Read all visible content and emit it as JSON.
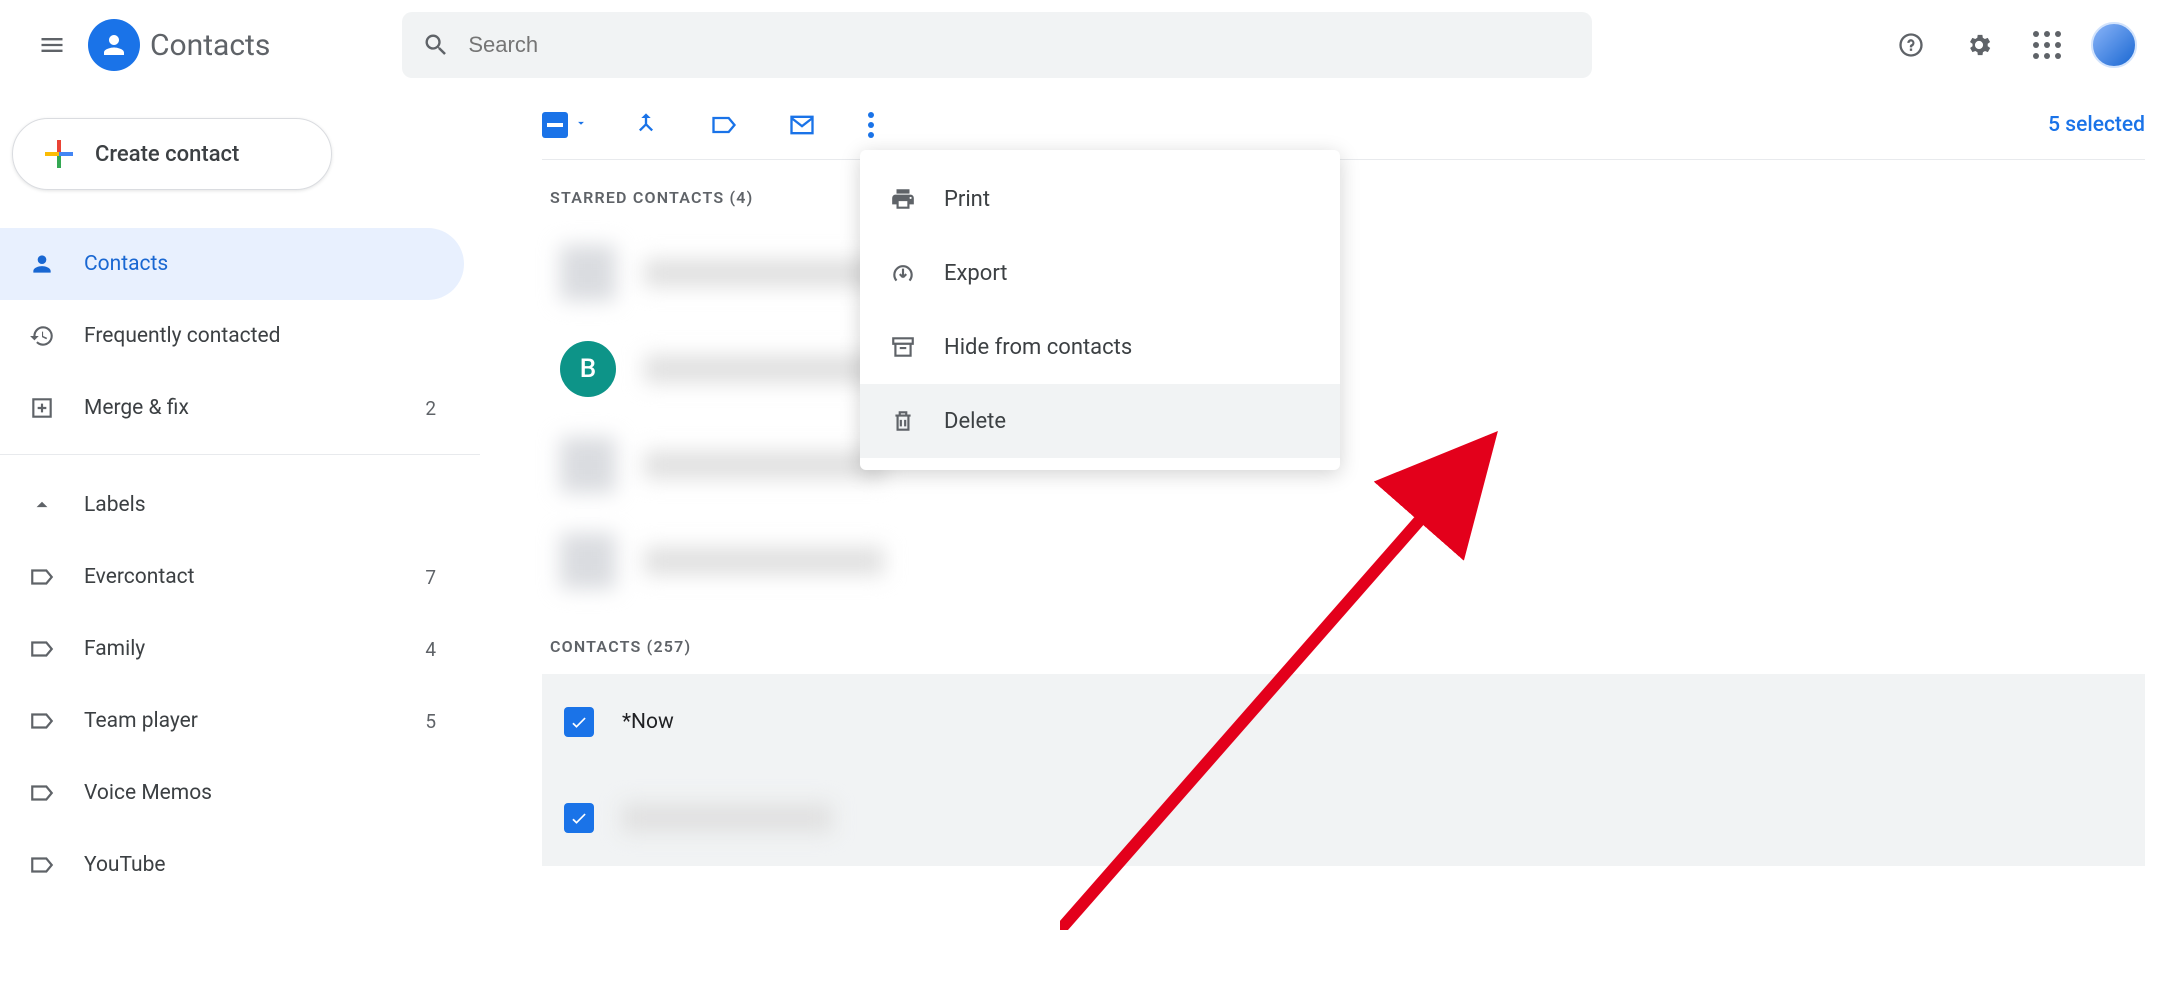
{
  "header": {
    "app_title": "Contacts",
    "search_placeholder": "Search"
  },
  "sidebar": {
    "create_label": "Create contact",
    "nav": {
      "contacts": "Contacts",
      "frequent": "Frequently contacted",
      "merge": "Merge & fix",
      "merge_count": "2"
    },
    "labels_header": "Labels",
    "labels": [
      {
        "name": "Evercontact",
        "count": "7"
      },
      {
        "name": "Family",
        "count": "4"
      },
      {
        "name": "Team player",
        "count": "5"
      },
      {
        "name": "Voice Memos",
        "count": ""
      },
      {
        "name": "YouTube",
        "count": ""
      }
    ]
  },
  "action_bar": {
    "selected_text": "5 selected"
  },
  "dropdown": {
    "print": "Print",
    "export": "Export",
    "hide": "Hide from contacts",
    "delete": "Delete"
  },
  "sections": {
    "starred": "Starred contacts (4)",
    "contacts": "Contacts (257)"
  },
  "contacts": {
    "starred_avatar_letter": "B",
    "row_now": "*Now"
  }
}
